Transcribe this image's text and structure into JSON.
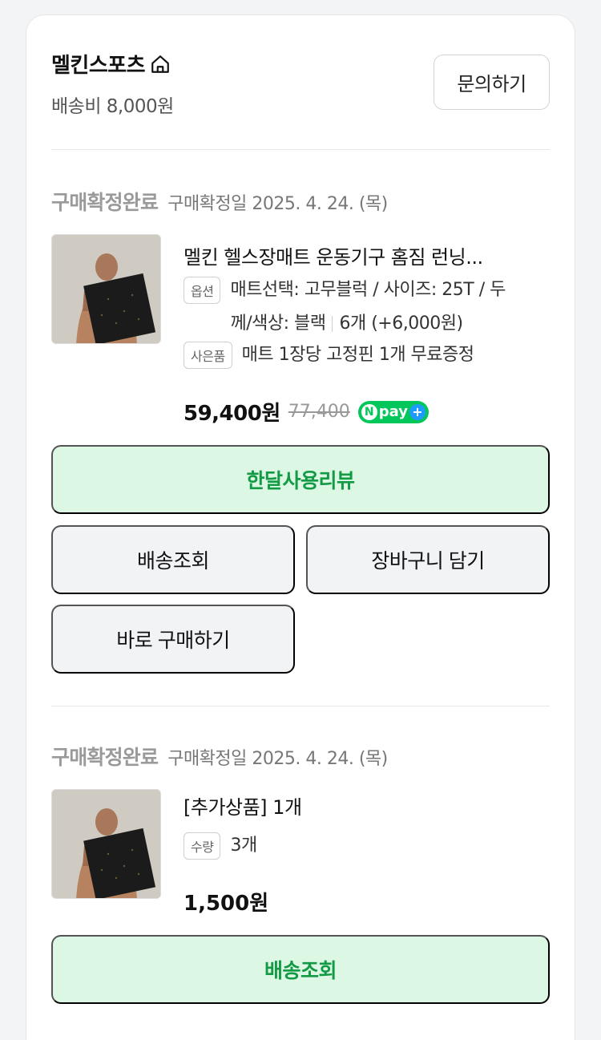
{
  "store": {
    "name": "멜킨스포츠",
    "shipping_fee": "배송비 8,000원",
    "inquiry_label": "문의하기"
  },
  "orders": [
    {
      "status": "구매확정완료",
      "confirm_date": "구매확정일 2025. 4. 24. (목)",
      "title": "멜킨 헬스장매트 운동기구 홈짐 런닝...",
      "option_tag": "옵션",
      "option_text_1": "매트선택: 고무블럭 / 사이즈: 25T / 두",
      "option_text_2": "께/색상: 블랙",
      "option_qty": "6개 (+6,000원)",
      "gift_tag": "사은품",
      "gift_text": "매트 1장당 고정핀 1개 무료증정",
      "price": "59,400원",
      "original_price": "77,400",
      "npay_label": "pay",
      "buttons": {
        "review": "한달사용리뷰",
        "track": "배송조회",
        "cart": "장바구니 담기",
        "buy_again": "바로 구매하기"
      }
    },
    {
      "status": "구매확정완료",
      "confirm_date": "구매확정일 2025. 4. 24. (목)",
      "title": "[추가상품] 1개",
      "qty_tag": "수량",
      "qty_text": "3개",
      "price": "1,500원",
      "buttons": {
        "track": "배송조회"
      }
    }
  ],
  "colors": {
    "accent_green": "#139a45",
    "green_button_bg": "#dcf7e3",
    "gray_button_bg": "#f2f3f5",
    "npay_green": "#03c75a"
  }
}
